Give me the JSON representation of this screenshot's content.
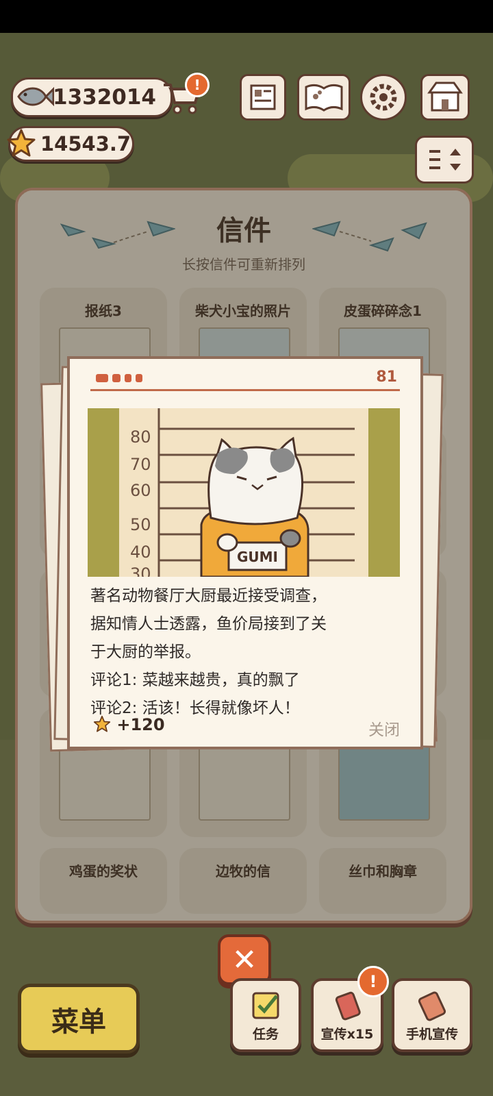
{
  "hud": {
    "fish_count": "1332014",
    "star_count": "14543.7",
    "cart_badge": "!"
  },
  "panel": {
    "title": "信件",
    "subtitle": "长按信件可重新排列",
    "cards": [
      {
        "label": "报纸3"
      },
      {
        "label": "柴犬小宝的照片"
      },
      {
        "label": "皮蛋碎碎念1"
      },
      {
        "label": "鸡蛋的奖状"
      },
      {
        "label": "边牧的信"
      },
      {
        "label": "丝巾和胸章"
      }
    ]
  },
  "letter": {
    "page_number": "81",
    "photo_sign": "GUMI",
    "ruler_marks": [
      "80",
      "70",
      "60",
      "50",
      "40",
      "30"
    ],
    "lines": [
      "著名动物餐厅大厨最近接受调查，",
      "据知情人士透露，鱼价局接到了关",
      "于大厨的举报。",
      "评论1: 菜越来越贵，真的飘了",
      "评论2: 活该！长得就像坏人！"
    ],
    "reward": "+120",
    "close_label": "关闭"
  },
  "bottom": {
    "menu_label": "菜单",
    "task_label": "任务",
    "promo_label": "宣传x15",
    "promo_badge": "!",
    "phone_promo_label": "手机宣传"
  },
  "colors": {
    "accent_orange": "#e46a3a",
    "menu_yellow": "#e7cb57",
    "outline_brown": "#5c3b2e"
  }
}
